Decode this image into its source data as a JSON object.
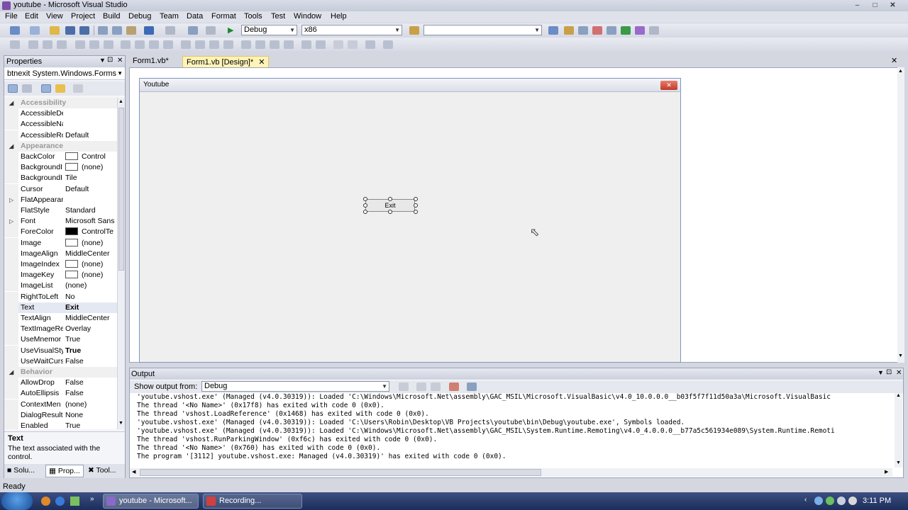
{
  "window": {
    "title": "youtube - Microsoft Visual Studio"
  },
  "menubar": {
    "items": [
      "File",
      "Edit",
      "View",
      "Project",
      "Build",
      "Debug",
      "Team",
      "Data",
      "Format",
      "Tools",
      "Test",
      "Window",
      "Help"
    ]
  },
  "toolbar": {
    "config_combo": "Debug",
    "platform_combo": "x86",
    "find_combo": ""
  },
  "properties": {
    "title": "Properties",
    "object": "btnexit System.Windows.Forms",
    "rows": [
      {
        "name": "Accessibility",
        "value": "",
        "category": true
      },
      {
        "name": "AccessibleDe",
        "value": ""
      },
      {
        "name": "AccessibleNa",
        "value": ""
      },
      {
        "name": "AccessibleRo",
        "value": "Default"
      },
      {
        "name": "Appearance",
        "value": "",
        "category": true
      },
      {
        "name": "BackColor",
        "value": "Control",
        "swatch": "#ffffff"
      },
      {
        "name": "BackgroundI",
        "value": "(none)",
        "swatch": "#ffffff"
      },
      {
        "name": "BackgroundI",
        "value": "Tile"
      },
      {
        "name": "Cursor",
        "value": "Default"
      },
      {
        "name": "FlatAppearan",
        "value": "",
        "expandable": true
      },
      {
        "name": "FlatStyle",
        "value": "Standard"
      },
      {
        "name": "Font",
        "value": "Microsoft Sans",
        "expandable": true
      },
      {
        "name": "ForeColor",
        "value": "ControlTe",
        "swatch": "#000000"
      },
      {
        "name": "Image",
        "value": "(none)",
        "swatch": "#ffffff"
      },
      {
        "name": "ImageAlign",
        "value": "MiddleCenter"
      },
      {
        "name": "ImageIndex",
        "value": "(none)",
        "swatch": "#ffffff"
      },
      {
        "name": "ImageKey",
        "value": "(none)",
        "swatch": "#ffffff"
      },
      {
        "name": "ImageList",
        "value": "(none)"
      },
      {
        "name": "RightToLeft",
        "value": "No"
      },
      {
        "name": "Text",
        "value": "Exit",
        "bold": true,
        "selected": true
      },
      {
        "name": "TextAlign",
        "value": "MiddleCenter"
      },
      {
        "name": "TextImageRe",
        "value": "Overlay"
      },
      {
        "name": "UseMnemor",
        "value": "True"
      },
      {
        "name": "UseVisualSty",
        "value": "True",
        "bold": true
      },
      {
        "name": "UseWaitCurs",
        "value": "False"
      },
      {
        "name": "Behavior",
        "value": "",
        "category": true
      },
      {
        "name": "AllowDrop",
        "value": "False"
      },
      {
        "name": "AutoEllipsis",
        "value": "False"
      },
      {
        "name": "ContextMen",
        "value": "(none)"
      },
      {
        "name": "DialogResult",
        "value": "None"
      },
      {
        "name": "Enabled",
        "value": "True"
      }
    ],
    "desc_title": "Text",
    "desc_text": "The text associated with the control.",
    "tabs": [
      "Solu...",
      "Prop...",
      "Tool..."
    ]
  },
  "doc_tabs": [
    {
      "label": "Form1.vb*",
      "active": false
    },
    {
      "label": "Form1.vb [Design]*",
      "active": true
    }
  ],
  "form": {
    "title": "Youtube",
    "button_text": "Exit"
  },
  "output": {
    "title": "Output",
    "show_from_label": "Show output from:",
    "show_from_value": "Debug",
    "lines": [
      "'youtube.vshost.exe' (Managed (v4.0.30319)): Loaded 'C:\\Windows\\Microsoft.Net\\assembly\\GAC_MSIL\\Microsoft.VisualBasic\\v4.0_10.0.0.0__b03f5f7f11d50a3a\\Microsoft.VisualBasic",
      "The thread '<No Name>' (0x17f8) has exited with code 0 (0x0).",
      "The thread 'vshost.LoadReference' (0x1468) has exited with code 0 (0x0).",
      "'youtube.vshost.exe' (Managed (v4.0.30319)): Loaded 'C:\\Users\\Robin\\Desktop\\VB Projects\\youtube\\bin\\Debug\\youtube.exe', Symbols loaded.",
      "'youtube.vshost.exe' (Managed (v4.0.30319)): Loaded 'C:\\Windows\\Microsoft.Net\\assembly\\GAC_MSIL\\System.Runtime.Remoting\\v4.0_4.0.0.0__b77a5c561934e089\\System.Runtime.Remoti",
      "The thread 'vshost.RunParkingWindow' (0xf6c) has exited with code 0 (0x0).",
      "The thread '<No Name>' (0x760) has exited with code 0 (0x0).",
      "The program '[3112] youtube.vshost.exe: Managed (v4.0.30319)' has exited with code 0 (0x0)."
    ]
  },
  "status": {
    "text": "Ready"
  },
  "taskbar": {
    "tasks": [
      "youtube - Microsoft...",
      "Recording..."
    ],
    "clock": "3:11 PM"
  }
}
